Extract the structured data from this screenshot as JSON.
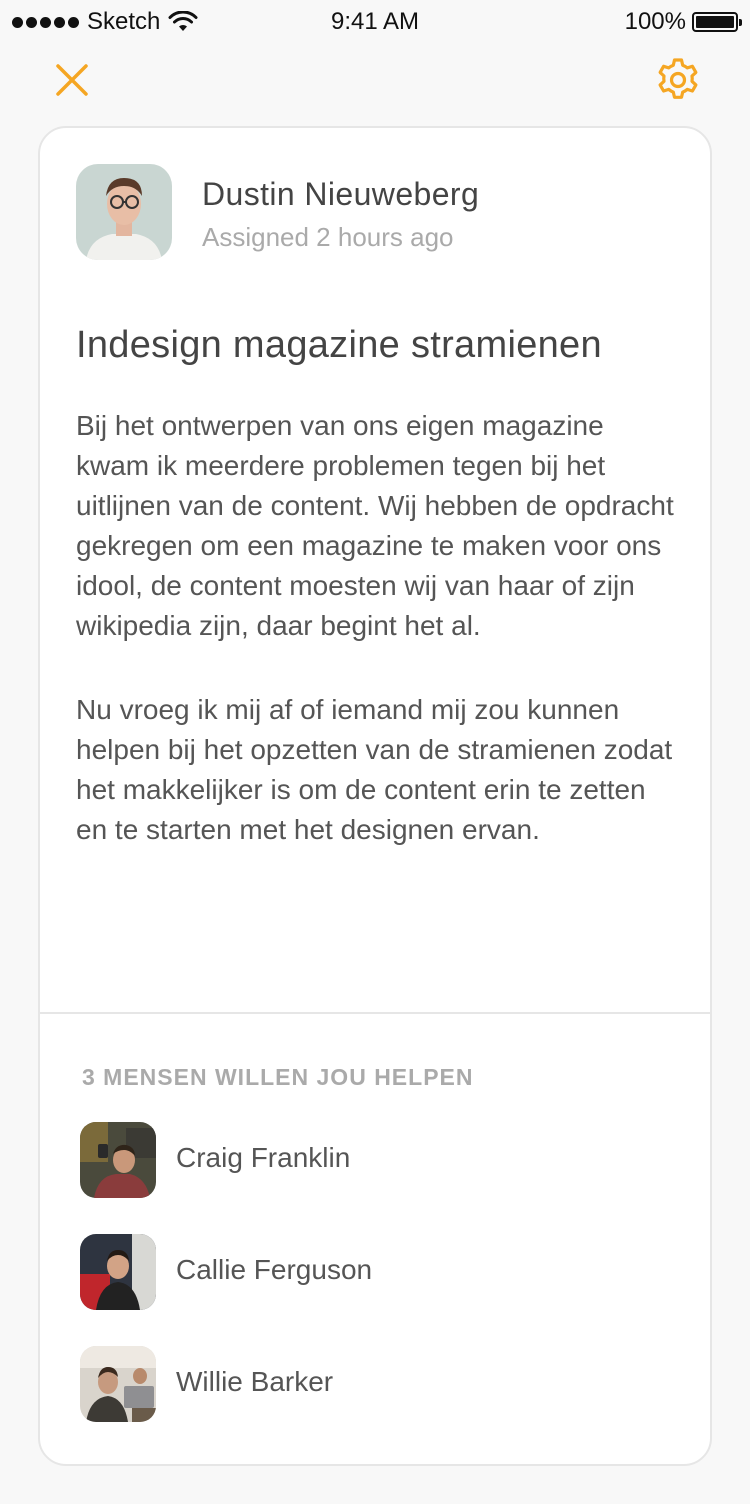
{
  "status_bar": {
    "carrier": "Sketch",
    "time": "9:41 AM",
    "battery": "100%"
  },
  "nav": {
    "close_icon": "close-icon",
    "settings_icon": "gear-icon",
    "accent_color": "#F5A623"
  },
  "post": {
    "author": {
      "name": "Dustin Nieuweberg",
      "assigned": "Assigned 2 hours ago"
    },
    "title": "Indesign magazine stramienen",
    "paragraphs": [
      "Bij het ontwerpen van ons eigen magazine kwam ik meerdere problemen tegen bij het uitlijnen van de content. Wij hebben de opdracht gekregen om een magazine te maken voor ons idool, de content moesten wij van haar of zijn wikipedia zijn, daar begint het al.",
      "Nu vroeg ik mij af of iemand mij zou kunnen helpen bij het opzetten van de stramienen zodat het makkelijker is om de content erin te zetten en te starten met het designen ervan."
    ]
  },
  "helpers": {
    "heading": "3 MENSEN WILLEN JOU HELPEN",
    "people": [
      {
        "name": "Craig Franklin"
      },
      {
        "name": "Callie Ferguson"
      },
      {
        "name": "Willie Barker"
      }
    ]
  }
}
